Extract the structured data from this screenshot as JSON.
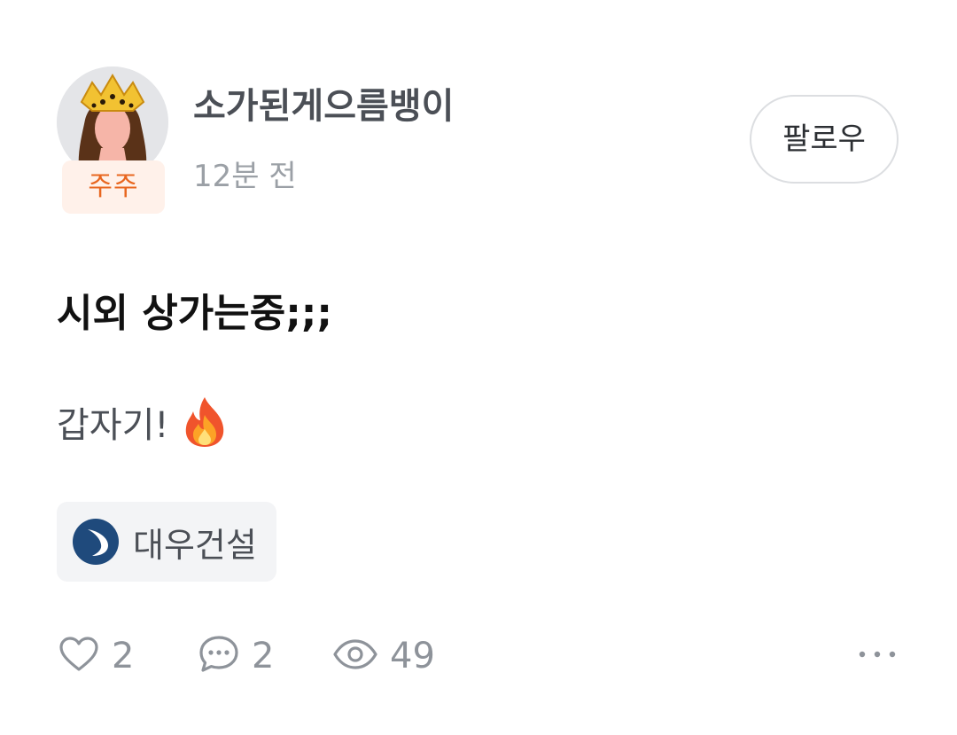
{
  "author": {
    "name": "소가된게으름뱅이",
    "holder_badge": "주주",
    "avatar_icon": "queen-crown-avatar"
  },
  "post": {
    "time_ago": "12분 전",
    "title": "시외 상가는중;;;",
    "body": "갑자기!",
    "body_emoji": "fire-emoji"
  },
  "follow": {
    "label": "팔로우"
  },
  "stock_tag": {
    "name": "대우건설",
    "logo_icon": "daewoo-logo-icon",
    "logo_color": "#1f4a7c"
  },
  "stats": {
    "likes": "2",
    "comments": "2",
    "views": "49"
  },
  "colors": {
    "badge_text": "#e8661f",
    "badge_bg": "#fff1ea",
    "muted_text": "#8e939a"
  }
}
